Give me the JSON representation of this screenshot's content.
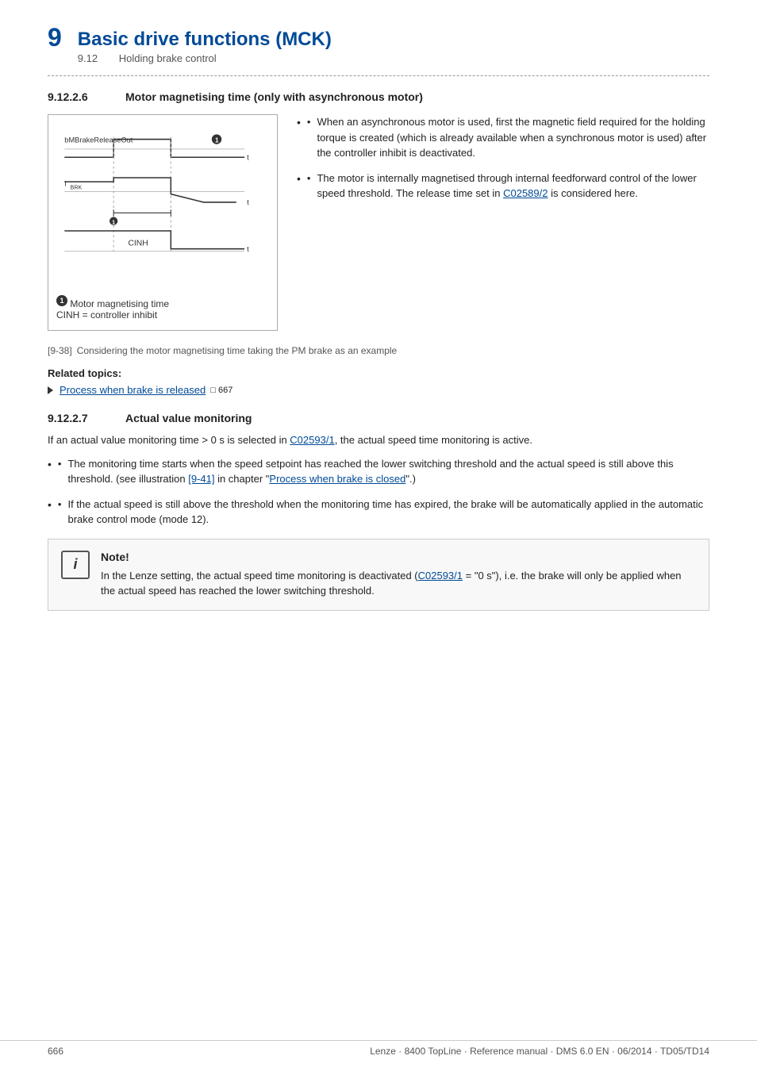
{
  "header": {
    "chapter_number": "9",
    "chapter_title": "Basic drive functions (MCK)",
    "section_number": "9.12",
    "section_title": "Holding brake control"
  },
  "divider": "dashed",
  "section_9126": {
    "number": "9.12.2.6",
    "title": "Motor magnetising time (only with asynchronous motor)",
    "diagram": {
      "label_bMBrakeReleaseOut": "bMBrakeReleaseOut",
      "label_iBRK": "I",
      "label_iBRK_sub": "BRK",
      "label_CINH": "CINH",
      "annotation_1": "❶",
      "axis_t": "t"
    },
    "diagram_legend": {
      "item1_num": "❶",
      "item1_text": "Motor magnetising time",
      "item2_text": "CINH = controller inhibit"
    },
    "figure_caption": {
      "ref": "[9-38]",
      "text": "Considering the motor magnetising time taking the PM brake as an example"
    },
    "bullets": [
      {
        "text": "When an asynchronous motor is used, first the magnetic field required for the holding torque is created (which is already available when a synchronous motor is used) after the controller inhibit is deactivated."
      },
      {
        "text": "The motor is internally magnetised through internal feedforward control of the lower speed threshold. The release time set in ",
        "link": "C02589/2",
        "text_after": " is considered here."
      }
    ],
    "related_topics": {
      "title": "Related topics:",
      "items": [
        {
          "text": "Process when brake is released",
          "link_text": "Process when brake is released",
          "page_ref": "667"
        }
      ]
    }
  },
  "section_9127": {
    "number": "9.12.2.7",
    "title": "Actual value monitoring",
    "intro": {
      "text": "If an actual value monitoring time > 0 s is selected in ",
      "link": "C02593/1",
      "text_after": ", the actual speed time monitoring is active."
    },
    "bullets": [
      {
        "text": "The monitoring time starts when the speed setpoint has reached the lower switching threshold and the actual speed is still above this threshold. (see illustration ",
        "link1": "[9-41]",
        "text_mid": " in chapter \"",
        "link2": "Process when brake is closed",
        "text_after": "\".)"
      },
      {
        "text": "If the actual speed is still above the threshold when the monitoring time has expired, the brake will be automatically applied in the automatic brake control mode (mode 12)."
      }
    ],
    "note": {
      "title": "Note!",
      "text": "In the Lenze setting, the actual speed time monitoring is deactivated (",
      "link": "C02593/1",
      "text_mid": " = \"0 s\"), i.e. the brake will only be applied when the actual speed has reached the lower switching threshold."
    }
  },
  "footer": {
    "page_number": "666",
    "reference": "Lenze · 8400 TopLine · Reference manual · DMS 6.0 EN · 06/2014 · TD05/TD14"
  }
}
